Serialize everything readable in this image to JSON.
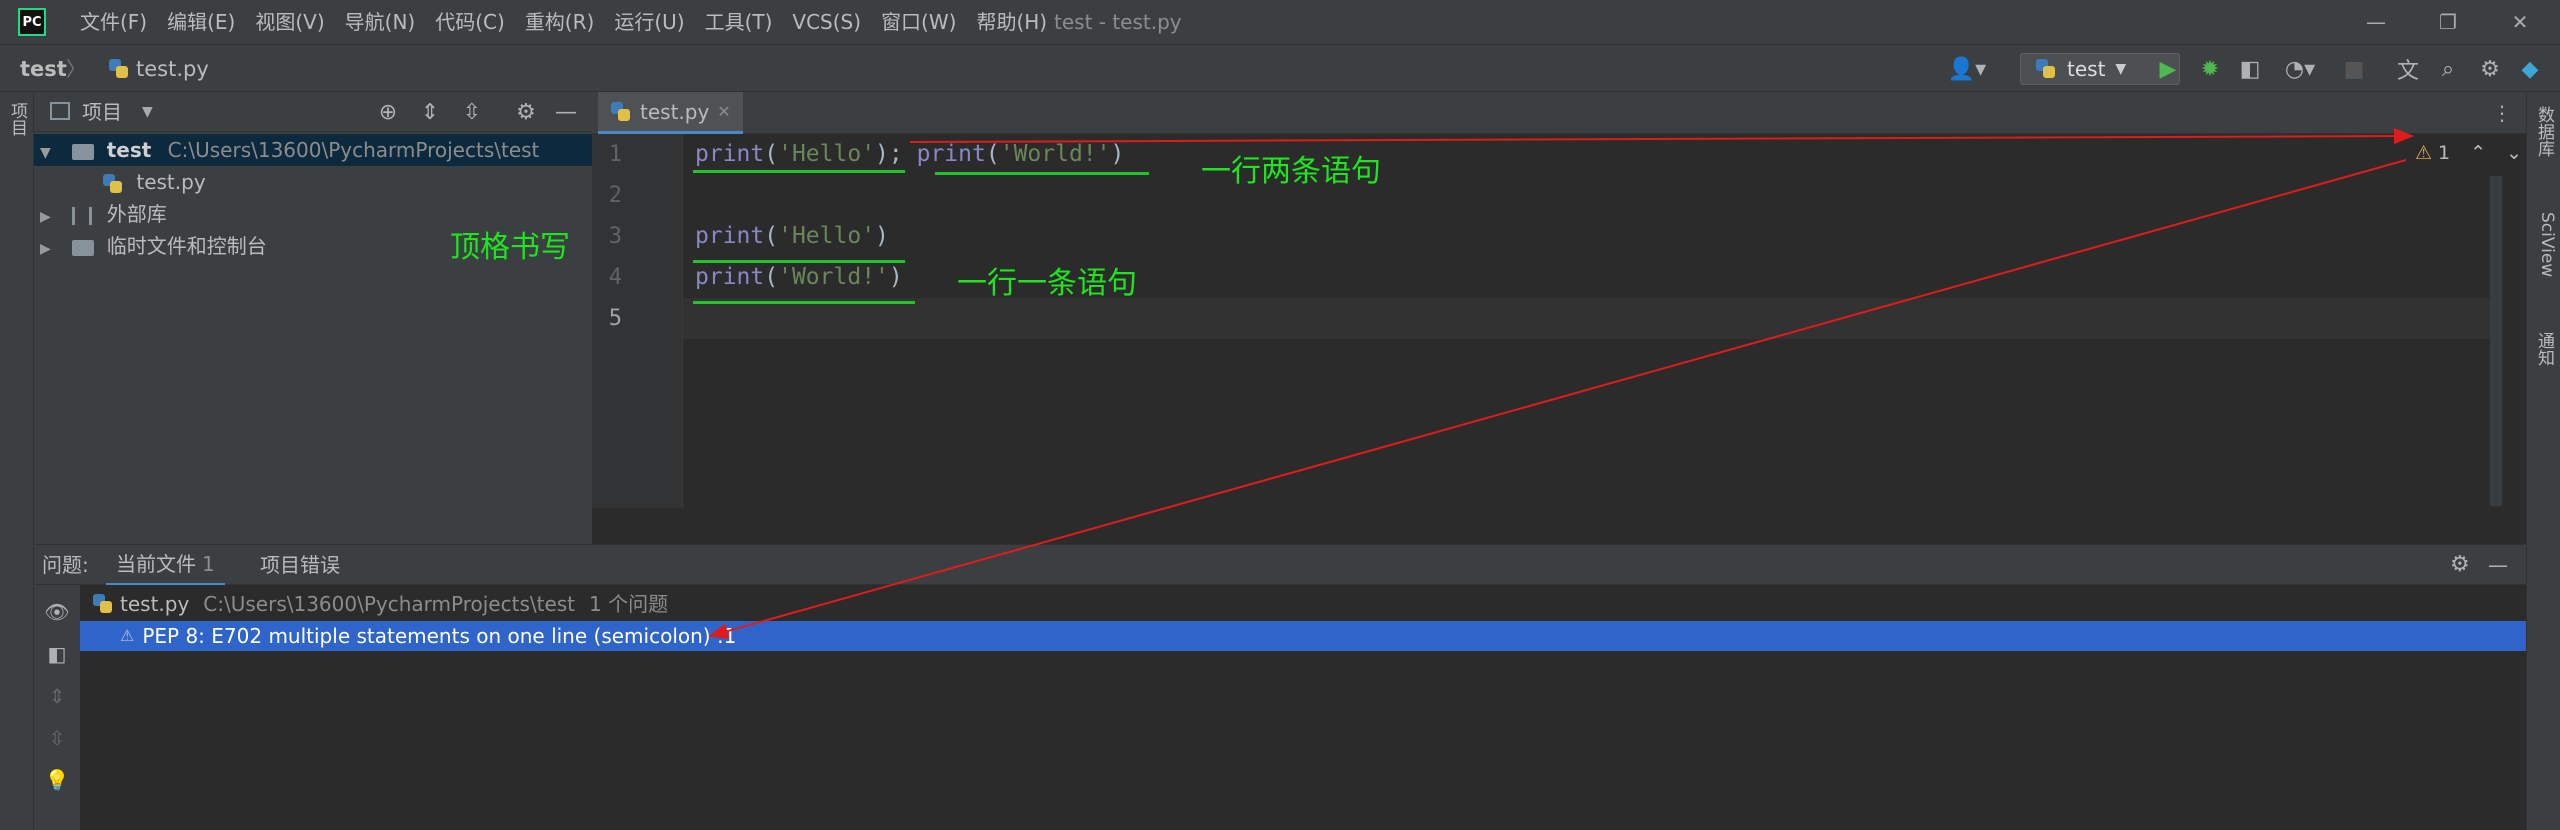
{
  "titlebar": {
    "menu": [
      "文件(F)",
      "编辑(E)",
      "视图(V)",
      "导航(N)",
      "代码(C)",
      "重构(R)",
      "运行(U)",
      "工具(T)",
      "VCS(S)",
      "窗口(W)",
      "帮助(H)"
    ],
    "window_title": "test - test.py",
    "app_logo_text": "PC"
  },
  "navbar": {
    "project": "test",
    "file": "test.py",
    "run_config": "test"
  },
  "left_strip": {
    "label": "项目"
  },
  "right_strip": {
    "labels": [
      "数据库",
      "SciView",
      "通知"
    ]
  },
  "project_panel": {
    "title": "项目",
    "tree": {
      "root_name": "test",
      "root_path": "C:\\Users\\13600\\PycharmProjects\\test",
      "file": "test.py",
      "external_libs": "外部库",
      "scratches": "临时文件和控制台"
    },
    "annotation": "顶格书写"
  },
  "editor": {
    "tab_label": "test.py",
    "line_numbers": [
      "1",
      "2",
      "3",
      "4",
      "5"
    ],
    "lines": [
      [
        {
          "t": "print",
          "c": "fn"
        },
        {
          "t": "(",
          "c": "pun"
        },
        {
          "t": "'Hello'",
          "c": "str"
        },
        {
          "t": ");",
          "c": "pun"
        },
        {
          "t": " ",
          "c": "pun"
        },
        {
          "t": "print",
          "c": "fn"
        },
        {
          "t": "(",
          "c": "pun"
        },
        {
          "t": "'World!'",
          "c": "str"
        },
        {
          "t": ")",
          "c": "pun"
        }
      ],
      [],
      [
        {
          "t": "print",
          "c": "fn"
        },
        {
          "t": "(",
          "c": "pun"
        },
        {
          "t": "'Hello'",
          "c": "str"
        },
        {
          "t": ")",
          "c": "pun"
        }
      ],
      [
        {
          "t": "print",
          "c": "fn"
        },
        {
          "t": "(",
          "c": "pun"
        },
        {
          "t": "'World!'",
          "c": "str"
        },
        {
          "t": ")",
          "c": "pun"
        }
      ],
      []
    ],
    "annotation_line1": "一行两条语句",
    "annotation_line4": "一行一条语句",
    "warning_count": "1"
  },
  "problems": {
    "label": "问题:",
    "tab_current": "当前文件",
    "tab_current_count": "1",
    "tab_project": "项目错误",
    "file": "test.py",
    "path": "C:\\Users\\13600\\PycharmProjects\\test",
    "count_text": "1 个问题",
    "issue": "PEP 8: E702 multiple statements on one line (semicolon) :1"
  },
  "colors": {
    "annotation_green": "#1ee61e",
    "arrow_red": "#e01b1b",
    "selection_blue": "#2f65ca",
    "tab_underline": "#4a88c7"
  }
}
